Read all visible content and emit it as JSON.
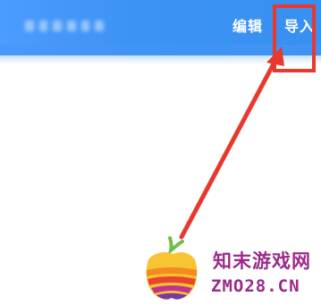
{
  "header": {
    "edit_label": "编辑",
    "import_label": "导入"
  },
  "annotation": {
    "highlight_color": "#e8392f",
    "arrow_color": "#e8392f"
  },
  "watermark": {
    "name": "知末游戏网",
    "url": "ZMO28.CN",
    "text_color": "#9b2a8a"
  },
  "colors": {
    "header_blue": "#3d93f3",
    "background": "#ffffff"
  }
}
